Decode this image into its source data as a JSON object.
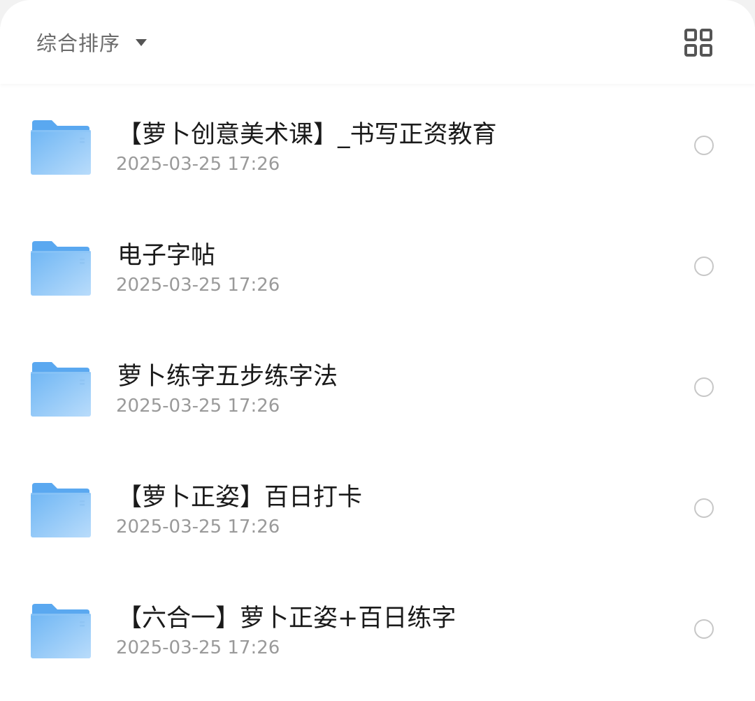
{
  "toolbar": {
    "sort_label": "综合排序",
    "sort_caret_icon": "caret-down-icon",
    "view_toggle_icon": "grid-view-icon"
  },
  "colors": {
    "folder_tab": "#5aa8f0",
    "folder_front_top": "#6fb6f4",
    "folder_front_bottom": "#b9dcfb",
    "title_text": "#1a1a1a",
    "date_text": "#9a9a9a",
    "radio_border": "#c7c7c7"
  },
  "files": [
    {
      "name": "【萝卜创意美术课】_书写正资教育",
      "date": "2025-03-25 17:26",
      "icon": "folder-icon",
      "selected": false
    },
    {
      "name": "电子字帖",
      "date": "2025-03-25 17:26",
      "icon": "folder-icon",
      "selected": false
    },
    {
      "name": "萝卜练字五步练字法",
      "date": "2025-03-25 17:26",
      "icon": "folder-icon",
      "selected": false
    },
    {
      "name": "【萝卜正姿】百日打卡",
      "date": "2025-03-25 17:26",
      "icon": "folder-icon",
      "selected": false
    },
    {
      "name": "【六合一】萝卜正姿+百日练字",
      "date": "2025-03-25 17:26",
      "icon": "folder-icon",
      "selected": false
    }
  ]
}
